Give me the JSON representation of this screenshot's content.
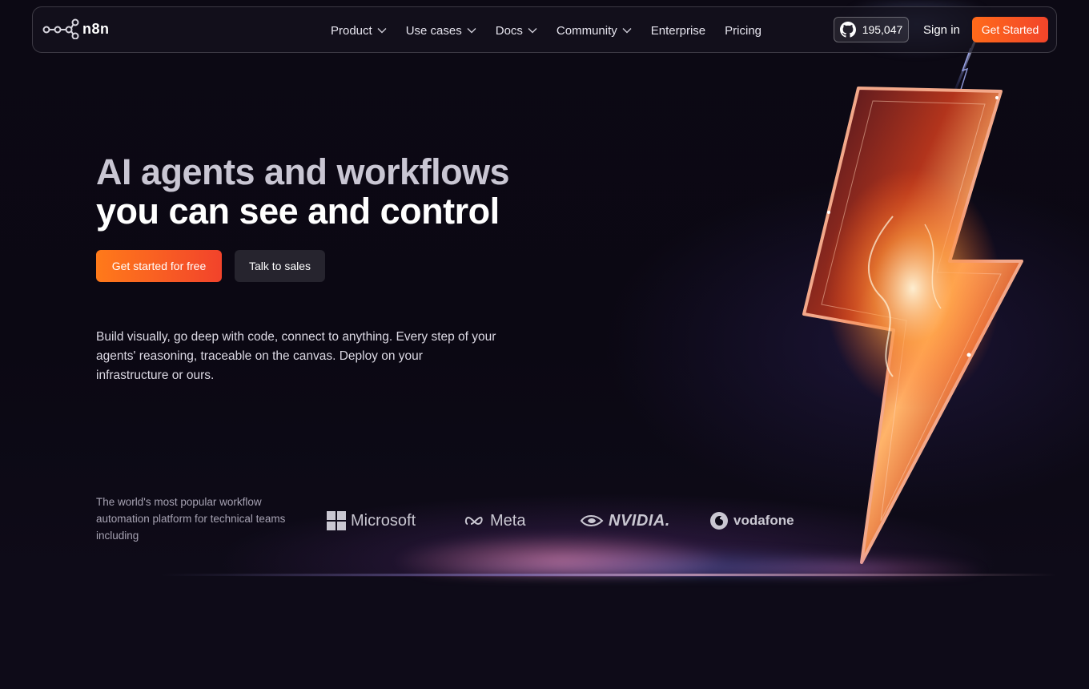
{
  "nav": {
    "logo_text": "n8n",
    "links": [
      {
        "label": "Product",
        "has_dropdown": true
      },
      {
        "label": "Use cases",
        "has_dropdown": true
      },
      {
        "label": "Docs",
        "has_dropdown": true
      },
      {
        "label": "Community",
        "has_dropdown": true
      },
      {
        "label": "Enterprise",
        "has_dropdown": false
      },
      {
        "label": "Pricing",
        "has_dropdown": false
      }
    ],
    "github_stars": "195,047",
    "github_icon": "github-icon",
    "sign_in": "Sign in",
    "get_started": "Get Started"
  },
  "hero": {
    "headline_line1": "AI agents and workflows",
    "headline_line2": "you can see and control",
    "cta_primary": "Get started for free",
    "cta_secondary": "Talk to sales",
    "description": "Build visually, go deep with code, connect to anything. Every step of your agents' reasoning, traceable on the canvas. Deploy on your infrastructure or ours.",
    "illustration": "lightning-bolt"
  },
  "trusted": {
    "text": "The world's most popular workflow automation platform for technical teams including",
    "brands": [
      "Microsoft",
      "Meta",
      "NVIDIA.",
      "vodafone"
    ]
  },
  "colors": {
    "background": "#0e0b18",
    "accent": "#ff6a1a",
    "accent_end": "#f2452a",
    "secondary_button": "#26242e"
  }
}
